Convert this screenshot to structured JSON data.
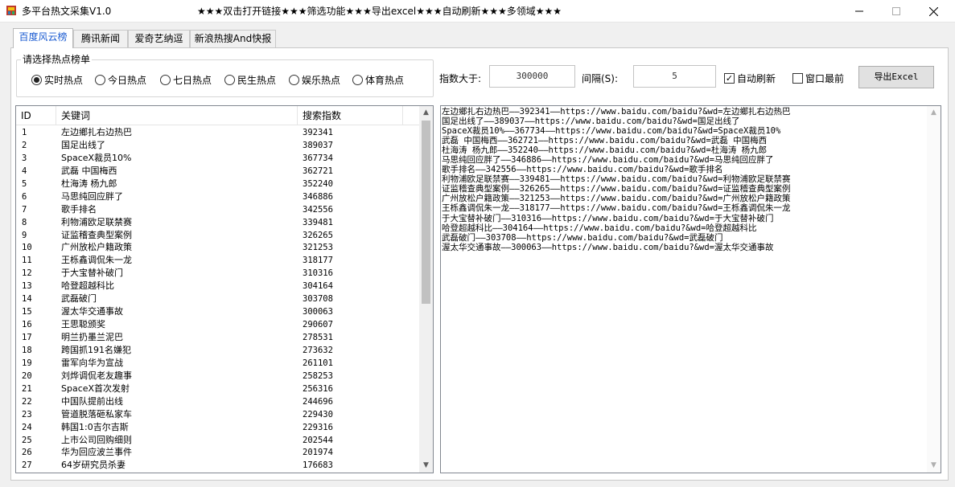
{
  "window": {
    "title": "多平台热文采集V1.0",
    "marquee": "★★★双击打开链接★★★筛选功能★★★导出excel★★★自动刷新★★★多领域★★★"
  },
  "tabs": [
    {
      "label": "百度风云榜",
      "active": true
    },
    {
      "label": "腾讯新闻",
      "active": false
    },
    {
      "label": "爱奇艺纳逗",
      "active": false
    },
    {
      "label": "新浪热搜And快报",
      "active": false
    }
  ],
  "filter_group": {
    "title": "请选择热点榜单",
    "options": [
      {
        "label": "实时热点",
        "selected": true
      },
      {
        "label": "今日热点",
        "selected": false
      },
      {
        "label": "七日热点",
        "selected": false
      },
      {
        "label": "民生热点",
        "selected": false
      },
      {
        "label": "娱乐热点",
        "selected": false
      },
      {
        "label": "体育热点",
        "selected": false
      }
    ]
  },
  "controls": {
    "index_label": "指数大于:",
    "index_value": "300000",
    "interval_label": "间隔(S):",
    "interval_value": "5",
    "auto_refresh_label": "自动刷新",
    "auto_refresh_checked": true,
    "topmost_label": "窗口最前",
    "topmost_checked": false,
    "export_label": "导出Excel"
  },
  "table": {
    "columns": [
      "ID",
      "关键词",
      "搜索指数"
    ],
    "rows": [
      [
        "1",
        "左边鄉扎右边热巴",
        "392341"
      ],
      [
        "2",
        "国足出线了",
        "389037"
      ],
      [
        "3",
        "SpaceX裁员10%",
        "367734"
      ],
      [
        "4",
        "武磊 中国梅西",
        "362721"
      ],
      [
        "5",
        "杜海涛 杨九郎",
        "352240"
      ],
      [
        "6",
        "马思纯回应胖了",
        "346886"
      ],
      [
        "7",
        "歌手排名",
        "342556"
      ],
      [
        "8",
        "利物浦欧足联禁赛",
        "339481"
      ],
      [
        "9",
        "证监稽查典型案例",
        "326265"
      ],
      [
        "10",
        "广州放松户籍政策",
        "321253"
      ],
      [
        "11",
        "王栎鑫调侃朱一龙",
        "318177"
      ],
      [
        "12",
        "于大宝替补破门",
        "310316"
      ],
      [
        "13",
        "哈登超越科比",
        "304164"
      ],
      [
        "14",
        "武磊破门",
        "303708"
      ],
      [
        "15",
        "渥太华交通事故",
        "300063"
      ],
      [
        "16",
        "王思聪颁奖",
        "290607"
      ],
      [
        "17",
        "明兰扔墨兰泥巴",
        "278531"
      ],
      [
        "18",
        "跨国抓191名嫌犯",
        "273632"
      ],
      [
        "19",
        "雷军向华为宣战",
        "261101"
      ],
      [
        "20",
        "刘烨调侃老友趣事",
        "258253"
      ],
      [
        "21",
        "SpaceX首次发射",
        "256316"
      ],
      [
        "22",
        "中国队提前出线",
        "244696"
      ],
      [
        "23",
        "管道脱落砸私家车",
        "229430"
      ],
      [
        "24",
        "韩国1:0吉尔吉斯",
        "229316"
      ],
      [
        "25",
        "上市公司回购细则",
        "202544"
      ],
      [
        "26",
        "华为回应波兰事件",
        "201974"
      ],
      [
        "27",
        "64岁研究员杀妻",
        "176683"
      ]
    ]
  },
  "output_lines": [
    "左边鄉扎右边热巴——392341——https://www.baidu.com/baidu?&wd=左边鄉扎右边热巴",
    "国足出线了——389037——https://www.baidu.com/baidu?&wd=国足出线了",
    "SpaceX裁员10%——367734——https://www.baidu.com/baidu?&wd=SpaceX裁员10%",
    "武磊 中国梅西——362721——https://www.baidu.com/baidu?&wd=武磊 中国梅西",
    "杜海涛 杨九郎——352240——https://www.baidu.com/baidu?&wd=杜海涛 杨九郎",
    "马思纯回应胖了——346886——https://www.baidu.com/baidu?&wd=马思纯回应胖了",
    "歌手排名——342556——https://www.baidu.com/baidu?&wd=歌手排名",
    "利物浦欧足联禁赛——339481——https://www.baidu.com/baidu?&wd=利物浦欧足联禁赛",
    "证监稽查典型案例——326265——https://www.baidu.com/baidu?&wd=证监稽查典型案例",
    "广州放松户籍政策——321253——https://www.baidu.com/baidu?&wd=广州放松户籍政策",
    "王栎鑫调侃朱一龙——318177——https://www.baidu.com/baidu?&wd=王栎鑫调侃朱一龙",
    "于大宝替补破门——310316——https://www.baidu.com/baidu?&wd=于大宝替补破门",
    "哈登超越科比——304164——https://www.baidu.com/baidu?&wd=哈登超越科比",
    "武磊破门——303708——https://www.baidu.com/baidu?&wd=武磊破门",
    "渥太华交通事故——300063——https://www.baidu.com/baidu?&wd=渥太华交通事故"
  ]
}
